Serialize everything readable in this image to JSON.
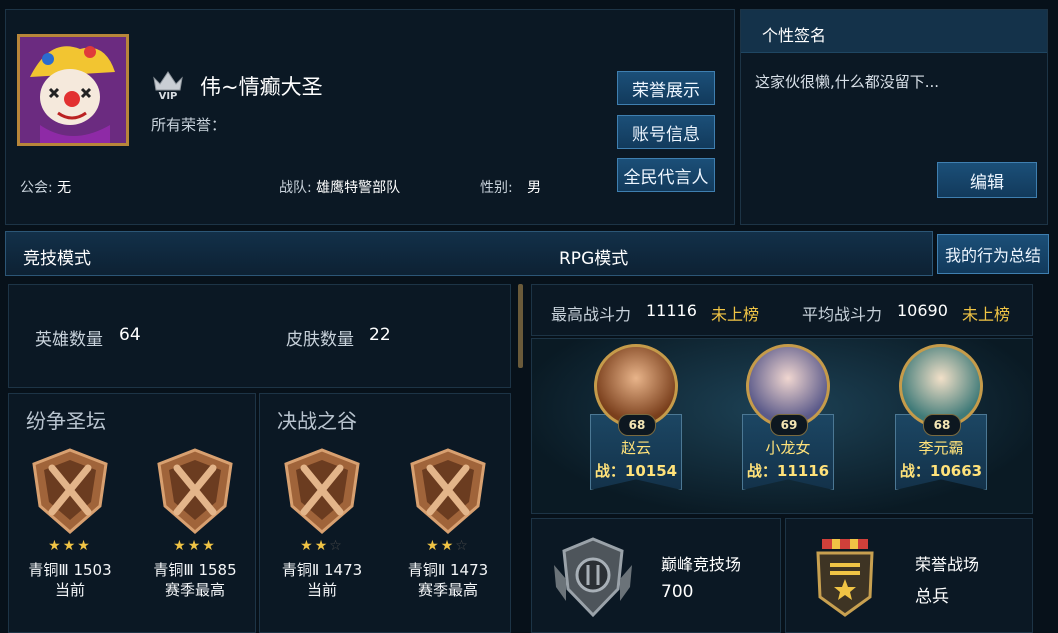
{
  "profile": {
    "name": "伟~情癫大圣",
    "vip_badge": "VIP",
    "honors_label": "所有荣誉：",
    "guild_label": "公会:",
    "guild_value": "无",
    "team_label": "战队:",
    "team_value": "雄鹰特警部队",
    "gender_label": "性别:",
    "gender_value": "男"
  },
  "profile_buttons": {
    "honor_display": "荣誉展示",
    "account_info": "账号信息",
    "ambassador": "全民代言人"
  },
  "signature": {
    "title": "个性签名",
    "text": "这家伙很懒,什么都没留下...",
    "edit_label": "编辑"
  },
  "tabs": {
    "competitive": "竞技模式",
    "rpg": "RPG模式",
    "behavior_summary": "我的行为总结"
  },
  "stats": {
    "hero_count_label": "英雄数量",
    "hero_count": "64",
    "skin_count_label": "皮肤数量",
    "skin_count": "22"
  },
  "maps": [
    {
      "title": "纷争圣坛",
      "ranks": [
        {
          "stars": 3,
          "tier": "青铜Ⅲ 1503",
          "note": "当前"
        },
        {
          "stars": 3,
          "tier": "青铜Ⅲ 1585",
          "note": "赛季最高"
        }
      ]
    },
    {
      "title": "决战之谷",
      "ranks": [
        {
          "stars": 2,
          "tier": "青铜Ⅱ 1473",
          "note": "当前"
        },
        {
          "stars": 2,
          "tier": "青铜Ⅱ 1473",
          "note": "赛季最高"
        }
      ]
    }
  ],
  "power": {
    "max_label": "最高战斗力",
    "max_value": "11116",
    "max_status": "未上榜",
    "avg_label": "平均战斗力",
    "avg_value": "10690",
    "avg_status": "未上榜"
  },
  "heroes": [
    {
      "name": "赵云",
      "level": "68",
      "power": "战：10154",
      "color": "#7a3f1c"
    },
    {
      "name": "小龙女",
      "level": "69",
      "power": "战：11116",
      "color": "#5b5a8a"
    },
    {
      "name": "李元霸",
      "level": "68",
      "power": "战：10663",
      "color": "#3f7a78"
    }
  ],
  "bottom": {
    "peak_title": "巅峰竞技场",
    "peak_value": "700",
    "honor_title": "荣誉战场",
    "honor_value": "总兵"
  },
  "colors": {
    "accent_gold": "#f0c445",
    "button_blue": "#1b4f78",
    "panel_bg": "#0b1824"
  }
}
